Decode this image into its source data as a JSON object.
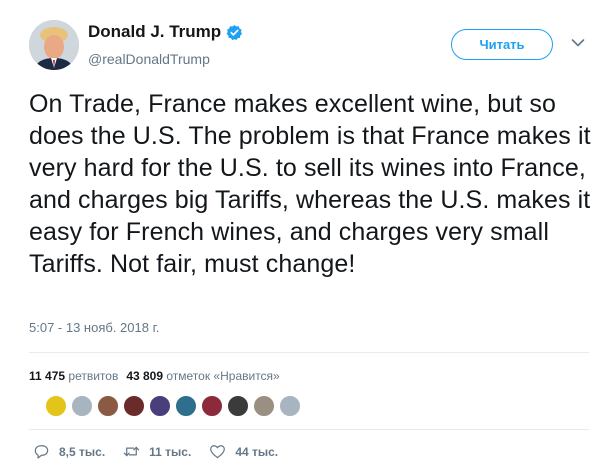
{
  "author": {
    "display_name": "Donald J. Trump",
    "handle": "@realDonaldTrump",
    "verified": true,
    "avatar_icon": "profile-photo"
  },
  "follow_button": {
    "label": "Читать"
  },
  "tweet": {
    "text": "On Trade, France makes excellent wine, but so does the U.S. The problem is that France makes it very hard for the U.S. to sell its wines into France, and charges big Tariffs, whereas the U.S. makes it easy for French wines, and charges very small Tariffs. Not fair, must change!",
    "timestamp": "5:07 - 13 нояб. 2018 г."
  },
  "stats": {
    "retweets_count": "11 475",
    "retweets_label": "ретвитов",
    "likes_count": "43 809",
    "likes_label": "отметок «Нравится»"
  },
  "likers": {
    "colors": [
      "#e3c51a",
      "#a8b4bf",
      "#8a5a44",
      "#6b2b2b",
      "#4a3f7a",
      "#2e6f8e",
      "#8c2a3c",
      "#3b3b3b",
      "#9a8f80",
      "#a8b4bf"
    ]
  },
  "actions": {
    "reply_count": "8,5 тыс.",
    "retweet_count": "11 тыс.",
    "like_count": "44 тыс."
  },
  "colors": {
    "accent": "#1da1f2",
    "secondary_text": "#657786",
    "divider": "#e6ecf0"
  }
}
